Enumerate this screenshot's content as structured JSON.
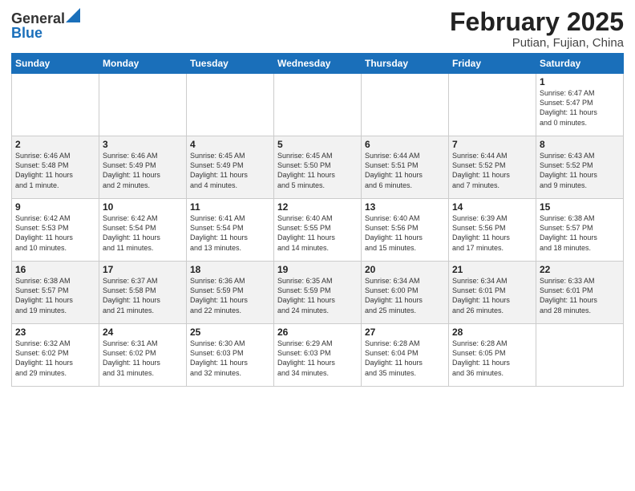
{
  "header": {
    "logo_general": "General",
    "logo_blue": "Blue",
    "title": "February 2025",
    "subtitle": "Putian, Fujian, China"
  },
  "days_of_week": [
    "Sunday",
    "Monday",
    "Tuesday",
    "Wednesday",
    "Thursday",
    "Friday",
    "Saturday"
  ],
  "weeks": [
    [
      {
        "day": "",
        "info": ""
      },
      {
        "day": "",
        "info": ""
      },
      {
        "day": "",
        "info": ""
      },
      {
        "day": "",
        "info": ""
      },
      {
        "day": "",
        "info": ""
      },
      {
        "day": "",
        "info": ""
      },
      {
        "day": "1",
        "info": "Sunrise: 6:47 AM\nSunset: 5:47 PM\nDaylight: 11 hours\nand 0 minutes."
      }
    ],
    [
      {
        "day": "2",
        "info": "Sunrise: 6:46 AM\nSunset: 5:48 PM\nDaylight: 11 hours\nand 1 minute."
      },
      {
        "day": "3",
        "info": "Sunrise: 6:46 AM\nSunset: 5:49 PM\nDaylight: 11 hours\nand 2 minutes."
      },
      {
        "day": "4",
        "info": "Sunrise: 6:45 AM\nSunset: 5:49 PM\nDaylight: 11 hours\nand 4 minutes."
      },
      {
        "day": "5",
        "info": "Sunrise: 6:45 AM\nSunset: 5:50 PM\nDaylight: 11 hours\nand 5 minutes."
      },
      {
        "day": "6",
        "info": "Sunrise: 6:44 AM\nSunset: 5:51 PM\nDaylight: 11 hours\nand 6 minutes."
      },
      {
        "day": "7",
        "info": "Sunrise: 6:44 AM\nSunset: 5:52 PM\nDaylight: 11 hours\nand 7 minutes."
      },
      {
        "day": "8",
        "info": "Sunrise: 6:43 AM\nSunset: 5:52 PM\nDaylight: 11 hours\nand 9 minutes."
      }
    ],
    [
      {
        "day": "9",
        "info": "Sunrise: 6:42 AM\nSunset: 5:53 PM\nDaylight: 11 hours\nand 10 minutes."
      },
      {
        "day": "10",
        "info": "Sunrise: 6:42 AM\nSunset: 5:54 PM\nDaylight: 11 hours\nand 11 minutes."
      },
      {
        "day": "11",
        "info": "Sunrise: 6:41 AM\nSunset: 5:54 PM\nDaylight: 11 hours\nand 13 minutes."
      },
      {
        "day": "12",
        "info": "Sunrise: 6:40 AM\nSunset: 5:55 PM\nDaylight: 11 hours\nand 14 minutes."
      },
      {
        "day": "13",
        "info": "Sunrise: 6:40 AM\nSunset: 5:56 PM\nDaylight: 11 hours\nand 15 minutes."
      },
      {
        "day": "14",
        "info": "Sunrise: 6:39 AM\nSunset: 5:56 PM\nDaylight: 11 hours\nand 17 minutes."
      },
      {
        "day": "15",
        "info": "Sunrise: 6:38 AM\nSunset: 5:57 PM\nDaylight: 11 hours\nand 18 minutes."
      }
    ],
    [
      {
        "day": "16",
        "info": "Sunrise: 6:38 AM\nSunset: 5:57 PM\nDaylight: 11 hours\nand 19 minutes."
      },
      {
        "day": "17",
        "info": "Sunrise: 6:37 AM\nSunset: 5:58 PM\nDaylight: 11 hours\nand 21 minutes."
      },
      {
        "day": "18",
        "info": "Sunrise: 6:36 AM\nSunset: 5:59 PM\nDaylight: 11 hours\nand 22 minutes."
      },
      {
        "day": "19",
        "info": "Sunrise: 6:35 AM\nSunset: 5:59 PM\nDaylight: 11 hours\nand 24 minutes."
      },
      {
        "day": "20",
        "info": "Sunrise: 6:34 AM\nSunset: 6:00 PM\nDaylight: 11 hours\nand 25 minutes."
      },
      {
        "day": "21",
        "info": "Sunrise: 6:34 AM\nSunset: 6:01 PM\nDaylight: 11 hours\nand 26 minutes."
      },
      {
        "day": "22",
        "info": "Sunrise: 6:33 AM\nSunset: 6:01 PM\nDaylight: 11 hours\nand 28 minutes."
      }
    ],
    [
      {
        "day": "23",
        "info": "Sunrise: 6:32 AM\nSunset: 6:02 PM\nDaylight: 11 hours\nand 29 minutes."
      },
      {
        "day": "24",
        "info": "Sunrise: 6:31 AM\nSunset: 6:02 PM\nDaylight: 11 hours\nand 31 minutes."
      },
      {
        "day": "25",
        "info": "Sunrise: 6:30 AM\nSunset: 6:03 PM\nDaylight: 11 hours\nand 32 minutes."
      },
      {
        "day": "26",
        "info": "Sunrise: 6:29 AM\nSunset: 6:03 PM\nDaylight: 11 hours\nand 34 minutes."
      },
      {
        "day": "27",
        "info": "Sunrise: 6:28 AM\nSunset: 6:04 PM\nDaylight: 11 hours\nand 35 minutes."
      },
      {
        "day": "28",
        "info": "Sunrise: 6:28 AM\nSunset: 6:05 PM\nDaylight: 11 hours\nand 36 minutes."
      },
      {
        "day": "",
        "info": ""
      }
    ]
  ]
}
